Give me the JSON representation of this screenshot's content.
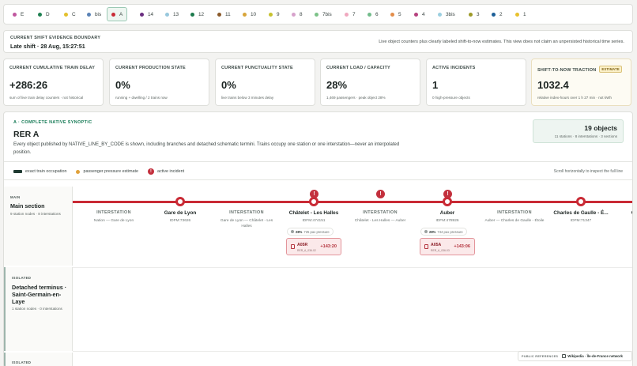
{
  "line_tabs": [
    {
      "label": "E",
      "color": "#c0579f"
    },
    {
      "label": "D",
      "color": "#1f8051"
    },
    {
      "label": "C",
      "color": "#e3c02c"
    },
    {
      "label": "bis",
      "color": "#5a82b6"
    },
    {
      "label": "A",
      "color": "#c92a35",
      "active": true
    },
    {
      "label": "14",
      "color": "#6a2d80"
    },
    {
      "label": "13",
      "color": "#98c8dd"
    },
    {
      "label": "12",
      "color": "#1d7a4c"
    },
    {
      "label": "11",
      "color": "#8a5a2a"
    },
    {
      "label": "10",
      "color": "#d8a53a"
    },
    {
      "label": "9",
      "color": "#c7c22e"
    },
    {
      "label": "8",
      "color": "#d7a2cc"
    },
    {
      "label": "7bis",
      "color": "#7cc288"
    },
    {
      "label": "7",
      "color": "#f0a8bf"
    },
    {
      "label": "6",
      "color": "#72bc8b"
    },
    {
      "label": "5",
      "color": "#e38d4a"
    },
    {
      "label": "4",
      "color": "#b6427e"
    },
    {
      "label": "3bis",
      "color": "#9bcfe0"
    },
    {
      "label": "3",
      "color": "#9d9a28"
    },
    {
      "label": "2",
      "color": "#1d5f98"
    },
    {
      "label": "1",
      "color": "#e8c12c"
    }
  ],
  "boundary": {
    "kicker": "CURRENT SHIFT EVIDENCE BOUNDARY",
    "title": "Late shift · 28 Aug, 15:27:51",
    "note": "Live object counters plus clearly labeled shift-to-now estimates. This view does not claim an unpersisted historical time series."
  },
  "metrics": [
    {
      "label": "CURRENT CUMULATIVE TRAIN DELAY",
      "value": "+286:26",
      "sub": "sum of live train delay counters · not historical"
    },
    {
      "label": "CURRENT PRODUCTION STATE",
      "value": "0%",
      "sub": "running + dwelling / 2 trains now"
    },
    {
      "label": "CURRENT PUNCTUALITY STATE",
      "value": "0%",
      "sub": "live trains below 3 minutes delay"
    },
    {
      "label": "CURRENT LOAD / CAPACITY",
      "value": "28%",
      "sub": "1,469 passengers · peak object 28%"
    },
    {
      "label": "ACTIVE INCIDENTS",
      "value": "1",
      "sub": "0 high-pressure objects"
    },
    {
      "label": "SHIFT-TO-NOW TRACTION",
      "badge": "ESTIMATE",
      "value": "1032.4",
      "sub": "relative index-hours over 1 h 27 min · not kWh"
    }
  ],
  "synoptic": {
    "kicker": "A · COMPLETE NATIVE SYNOPTIC",
    "title": "RER A",
    "description": "Every object published by NATIVE_LINE_BY_CODE is shown, including branches and detached schematic termini. Trains occupy one station or one interstation—never an interpolated position.",
    "objects_count": "19 objects",
    "objects_sub": "11 stations · 8 interstations · 3 sections",
    "legend": {
      "occupation": "exact train occupation",
      "pressure": "passenger pressure estimate",
      "incident": "active incident",
      "incident_glyph": "!"
    },
    "scroll_hint": "Scroll horizontally to inspect the full line"
  },
  "sections": [
    {
      "kicker": "MAIN",
      "name": "Main section",
      "sub": "9 station nodes · 8 interstations"
    },
    {
      "kicker": "ISOLATED",
      "name": "Detached terminus · Saint-Germain-en-Laye",
      "sub": "1 station nodes · 0 interstations"
    },
    {
      "kicker": "ISOLATED"
    }
  ],
  "track": {
    "interstations": [
      {
        "label": "INTERSTATION",
        "sub": "Nation — Gare de Lyon"
      },
      {
        "label": "INTERSTATION",
        "sub": "Gare de Lyon — Châtelet - Les Halles"
      },
      {
        "label": "INTERSTATION",
        "sub": "Châtelet - Les Halles — Auber"
      },
      {
        "label": "INTERSTATION",
        "sub": "Auber — Charles de Gaulle - Étoile"
      }
    ],
    "stations": [
      {
        "name": "Gare de Lyon",
        "id": "IDFM:73626"
      },
      {
        "name": "Châtelet - Les Halles",
        "id": "IDFM:474151"
      },
      {
        "name": "Auber",
        "id": "IDFM:478926"
      },
      {
        "name": "Charles de Gaulle - É...",
        "id": "IDFM:71347"
      },
      {
        "name": "C"
      }
    ],
    "pressures": [
      {
        "pct": "28%",
        "text": "725 pax pressure"
      },
      {
        "pct": "28%",
        "text": "744 pax pressure"
      }
    ],
    "trains": [
      {
        "code": "A05R",
        "run": "RER_A_036-02",
        "delay": "+143:20"
      },
      {
        "code": "A05A",
        "run": "RER_A_036-03",
        "delay": "+143:06"
      }
    ]
  },
  "references": {
    "kicker": "PUBLIC REFERENCES",
    "links": [
      "Wikipedia · Île-de-France network"
    ]
  }
}
